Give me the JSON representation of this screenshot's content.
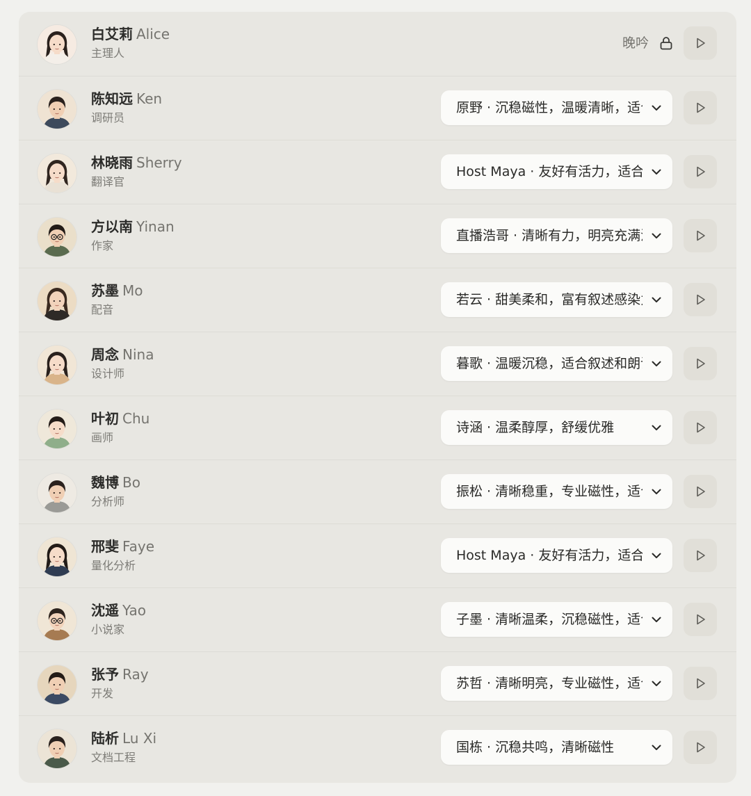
{
  "rows": [
    {
      "cn": "白艾莉",
      "en": "Alice",
      "role": "主理人",
      "voice": "晚吟",
      "locked": true,
      "avatar": {
        "skin": "#f6dcc9",
        "hair": "#2a211d",
        "shirt": "#f4efe9",
        "bg": "#f6ebe2",
        "long": true
      }
    },
    {
      "cn": "陈知远",
      "en": "Ken",
      "role": "调研员",
      "voice": "原野 · 沉稳磁性，温暖清晰，适合叙述",
      "locked": false,
      "avatar": {
        "skin": "#f0cfb4",
        "hair": "#2a211d",
        "shirt": "#3d4a5c",
        "bg": "#efe3d3",
        "long": false
      }
    },
    {
      "cn": "林晓雨",
      "en": "Sherry",
      "role": "翻译官",
      "voice": "Host Maya · 友好有活力，适合播客",
      "locked": false,
      "avatar": {
        "skin": "#f6dcc9",
        "hair": "#30251f",
        "shirt": "#e9e1d5",
        "bg": "#f2e9dc",
        "long": true
      }
    },
    {
      "cn": "方以南",
      "en": "Yinan",
      "role": "作家",
      "voice": "直播浩哥 · 清晰有力，明亮充满活力",
      "locked": false,
      "avatar": {
        "skin": "#f0cfb4",
        "hair": "#221b17",
        "shirt": "#5a6b4f",
        "bg": "#eadfca",
        "long": false,
        "glasses": true
      }
    },
    {
      "cn": "苏墨",
      "en": "Mo",
      "role": "配音",
      "voice": "若云 · 甜美柔和，富有叙述感染力",
      "locked": false,
      "avatar": {
        "skin": "#f2d3bb",
        "hair": "#3a2a20",
        "shirt": "#2e2a27",
        "bg": "#ecdcc4",
        "long": true
      }
    },
    {
      "cn": "周念",
      "en": "Nina",
      "role": "设计师",
      "voice": "暮歌 · 温暖沉稳，适合叙述和朗读",
      "locked": false,
      "avatar": {
        "skin": "#f6dcc9",
        "hair": "#2a211d",
        "shirt": "#d9b48a",
        "bg": "#f1e6d6",
        "long": true
      }
    },
    {
      "cn": "叶初",
      "en": "Chu",
      "role": "画师",
      "voice": "诗涵 · 温柔醇厚，舒缓优雅",
      "locked": false,
      "avatar": {
        "skin": "#f6dcc9",
        "hair": "#241c18",
        "shirt": "#8fae8a",
        "bg": "#efe8da",
        "long": false
      }
    },
    {
      "cn": "魏博",
      "en": "Bo",
      "role": "分析师",
      "voice": "振松 · 清晰稳重，专业磁性，适合讲解",
      "locked": false,
      "avatar": {
        "skin": "#f0cfb4",
        "hair": "#2a211d",
        "shirt": "#9a9a96",
        "bg": "#eeeae3",
        "long": false
      }
    },
    {
      "cn": "邢斐",
      "en": "Faye",
      "role": "量化分析",
      "voice": "Host Maya · 友好有活力，适合播客",
      "locked": false,
      "avatar": {
        "skin": "#f6dcc9",
        "hair": "#221b17",
        "shirt": "#2f3c52",
        "bg": "#efe5d4",
        "long": true
      }
    },
    {
      "cn": "沈遥",
      "en": "Yao",
      "role": "小说家",
      "voice": "子墨 · 清晰温柔，沉稳磁性，适合叙述",
      "locked": false,
      "avatar": {
        "skin": "#f2d3bb",
        "hair": "#2e241e",
        "shirt": "#a67b52",
        "bg": "#f0e6d6",
        "long": false,
        "glasses": true
      }
    },
    {
      "cn": "张予",
      "en": "Ray",
      "role": "开发",
      "voice": "苏哲 · 清晰明亮，专业磁性，适合讲解",
      "locked": false,
      "avatar": {
        "skin": "#f0cfb4",
        "hair": "#231b16",
        "shirt": "#3b4a63",
        "bg": "#e6d6bd",
        "long": false
      }
    },
    {
      "cn": "陆析",
      "en": "Lu Xi",
      "role": "文档工程",
      "voice": "国栋 · 沉稳共鸣，清晰磁性",
      "locked": false,
      "avatar": {
        "skin": "#f0cfb4",
        "hair": "#2a211d",
        "shirt": "#4a5a4a",
        "bg": "#ece4d6",
        "long": false
      }
    }
  ]
}
